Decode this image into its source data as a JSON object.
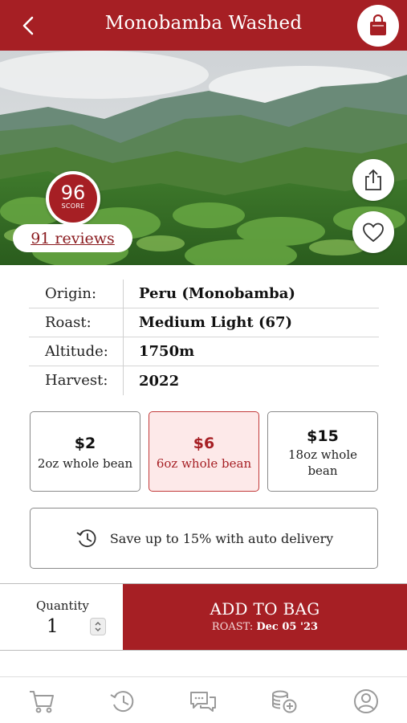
{
  "header": {
    "title": "Monobamba Washed",
    "back_icon": "chevron-left-icon",
    "bag_icon": "shopping-bag-icon"
  },
  "hero": {
    "score": "96",
    "score_label": "SCORE",
    "reviews_label": "91 reviews",
    "share_icon": "share-icon",
    "favorite_icon": "heart-icon"
  },
  "details": [
    {
      "label": "Origin:",
      "value": "Peru (Monobamba)"
    },
    {
      "label": "Roast:",
      "value": "Medium Light (67)"
    },
    {
      "label": "Altitude:",
      "value": "1750m"
    },
    {
      "label": "Harvest:",
      "value": "2022"
    }
  ],
  "sizes": [
    {
      "price": "$2",
      "desc": "2oz whole bean",
      "selected": false
    },
    {
      "price": "$6",
      "desc": "6oz whole bean",
      "selected": true
    },
    {
      "price": "$15",
      "desc": "18oz whole bean",
      "selected": false
    }
  ],
  "auto_delivery": {
    "icon": "history-icon",
    "text": "Save up to 15% with auto delivery"
  },
  "purchase": {
    "quantity_label": "Quantity",
    "quantity_value": "1",
    "add_label": "ADD TO BAG",
    "roast_prefix": "ROAST:",
    "roast_date": "Dec 05 '23"
  },
  "tabbar": [
    "cart-icon",
    "history-icon",
    "chat-icon",
    "coins-add-icon",
    "profile-icon"
  ],
  "colors": {
    "brand": "#a61f24",
    "selected_bg": "#fde9e9",
    "tab_icon": "#9a9a9a"
  }
}
